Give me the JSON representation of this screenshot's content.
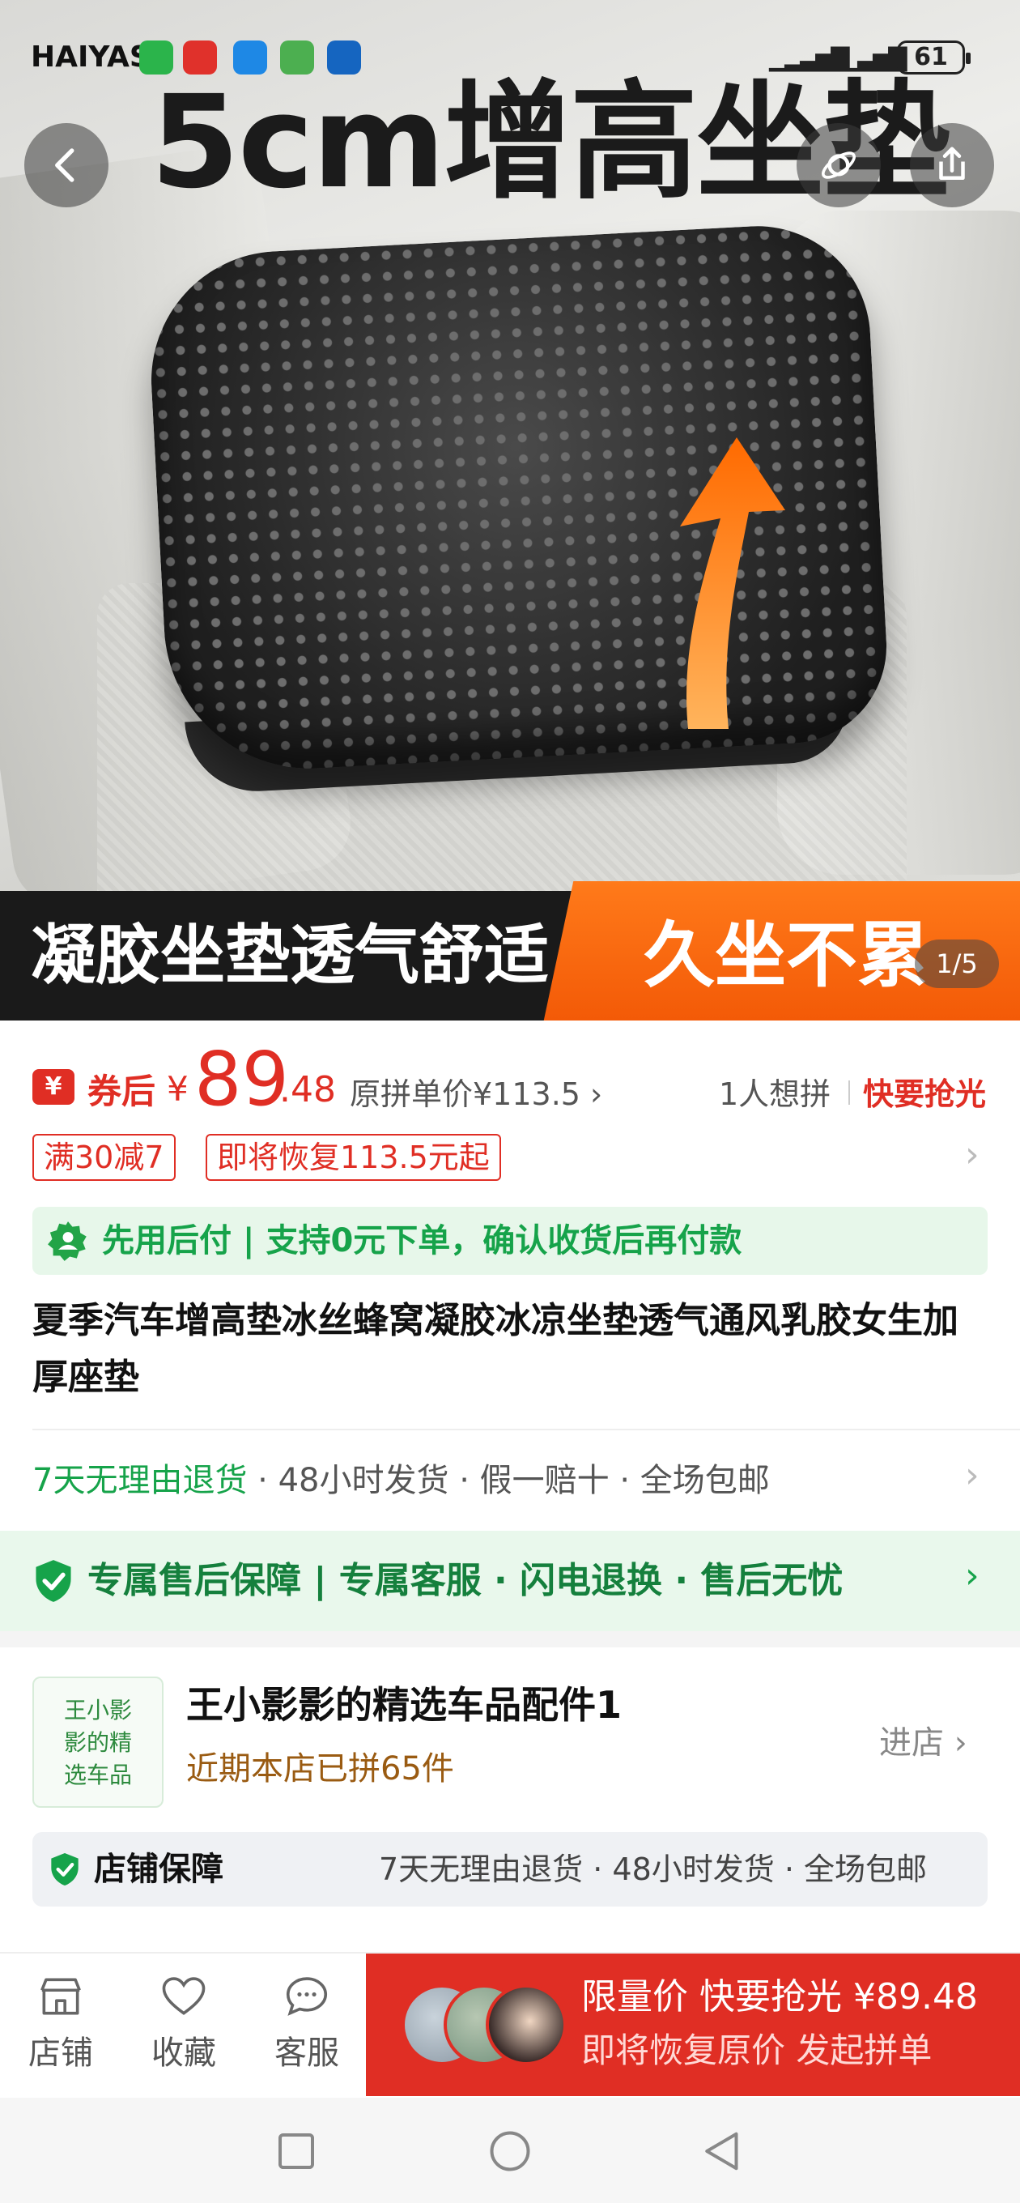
{
  "status_bar": {
    "time": "HAIYAST",
    "battery": "61"
  },
  "hero": {
    "title": "5cm增高坐垫",
    "banner_left": "凝胶坐垫透气舒适",
    "banner_right": "久坐不累",
    "counter": "1/5"
  },
  "price": {
    "prefix": "券后",
    "currency": "¥",
    "integer": "89",
    "decimal": ".48",
    "original": "原拼单价¥113.5",
    "want": "1人想拼",
    "hurry": "快要抢光"
  },
  "tags": [
    "满30减7",
    "即将恢复113.5元起"
  ],
  "pay_later": "先用后付 | 支持0元下单，确认收货后再付款",
  "product_title": "夏季汽车增高垫冰丝蜂窝凝胶冰凉坐垫透气通风乳胶女生加厚座垫",
  "services": {
    "highlight": "7天无理由退货",
    "rest": " · 48小时发货 · 假一赔十 · 全场包邮"
  },
  "guarantee": "专属售后保障 | 专属客服 · 闪电退换 · 售后无忧",
  "store": {
    "logo_text": "王小影影的精选车品",
    "name": "王小影影的精选车品配件1",
    "sales": "近期本店已拼65件",
    "enter": "进店",
    "guard_title": "店铺保障",
    "guard_items": "7天无理由退货 · 48小时发货 · 全场包邮"
  },
  "bottom_bar": {
    "store": "店铺",
    "favorite": "收藏",
    "service": "客服",
    "buy_line1": "限量价 快要抢光 ¥89.48",
    "buy_line2": "即将恢复原价 发起拼单"
  },
  "colors": {
    "accent_red": "#e02e24",
    "green": "#16a34a",
    "orange": "#f35a07"
  }
}
